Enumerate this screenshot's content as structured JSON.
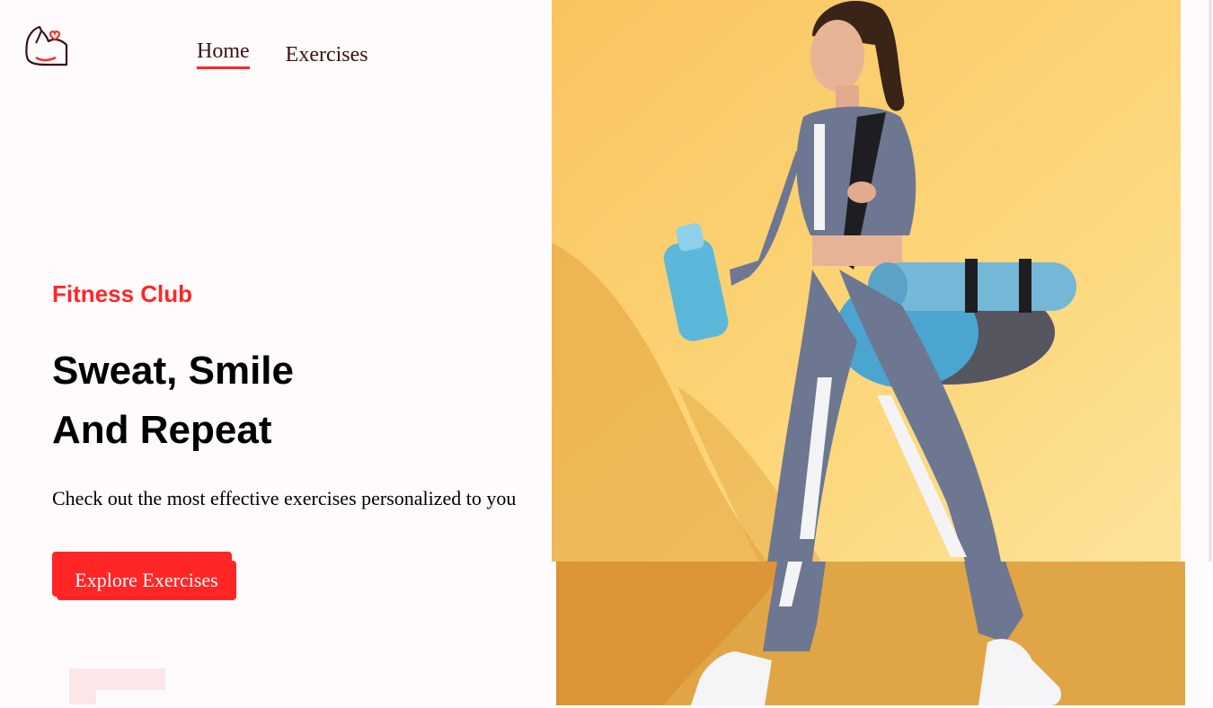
{
  "nav": {
    "links": [
      {
        "label": "Home",
        "active": true
      },
      {
        "label": "Exercises",
        "active": false
      }
    ]
  },
  "logo": {
    "icon": "flexed-arm-heart-icon",
    "color": "#ff2625"
  },
  "hero": {
    "eyebrow": "Fitness Club",
    "headline_line1": "Sweat, Smile",
    "headline_line2": "And Repeat",
    "subtitle": "Check out the most effective exercises personalized to you",
    "cta_label": "Explore Exercises"
  },
  "banner": {
    "image": "woman-walking-with-yoga-mat-and-shaker",
    "background": "#fbd978"
  },
  "colors": {
    "accent": "#ff2625",
    "page_bg": "#fffafb",
    "nav_text": "#3a1212"
  }
}
